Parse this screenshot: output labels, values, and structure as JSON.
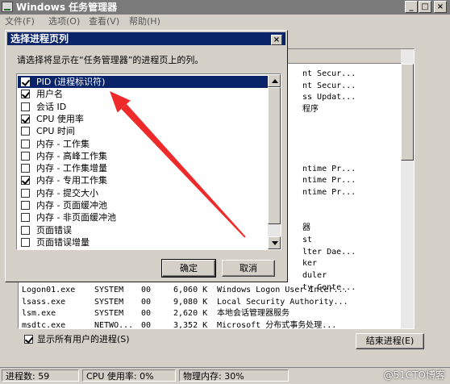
{
  "window": {
    "title": "Windows 任务管理器",
    "minimize": "_",
    "maximize": "□",
    "close": "×"
  },
  "menu": [
    "文件(F)",
    "选项(O)",
    "查看(V)",
    "帮助(H)"
  ],
  "background_list": {
    "right_fragments": [
      "nt Secur...",
      "nt Secur...",
      "ss Updat...",
      "程序",
      "",
      "",
      "",
      "",
      "ntime Pr...",
      "ntime Pr...",
      "ntime Pr...",
      "",
      "",
      "器",
      "st",
      "lter Dae...",
      "ker",
      "duler",
      "ty Cente..."
    ],
    "rows": [
      {
        "name": "Logon01.exe",
        "user": "SYSTEM",
        "cpu": "00",
        "mem": "6,060 K",
        "desc": "Windows Logon User Inter..."
      },
      {
        "name": "lsass.exe",
        "user": "SYSTEM",
        "cpu": "00",
        "mem": "9,080 K",
        "desc": "Local Security Authority..."
      },
      {
        "name": "lsm.exe",
        "user": "SYSTEM",
        "cpu": "00",
        "mem": "2,620 K",
        "desc": "本地会话管理器服务"
      },
      {
        "name": "msdtc.exe",
        "user": "NETWO...",
        "cpu": "00",
        "mem": "3,352 K",
        "desc": "Microsoft 分布式事务处理..."
      }
    ],
    "show_all_users_label": "显示所有用户的进程(S)",
    "show_all_users_checked": true,
    "end_process_label": "结束进程(E)"
  },
  "status": {
    "processes": "进程数: 59",
    "cpu": "CPU 使用率: 0%",
    "memory": "物理内存: 30%"
  },
  "watermark": "@51CTO博客",
  "dialog": {
    "title": "选择进程页列",
    "close": "×",
    "prompt": "请选择将显示在“任务管理器”的进程页上的列。",
    "columns": [
      {
        "label": "PID (进程标识符)",
        "checked": true,
        "selected": true
      },
      {
        "label": "用户名",
        "checked": true,
        "selected": false
      },
      {
        "label": "会话 ID",
        "checked": false,
        "selected": false
      },
      {
        "label": "CPU 使用率",
        "checked": true,
        "selected": false
      },
      {
        "label": "CPU 时间",
        "checked": false,
        "selected": false
      },
      {
        "label": "内存 - 工作集",
        "checked": false,
        "selected": false
      },
      {
        "label": "内存 - 高峰工作集",
        "checked": false,
        "selected": false
      },
      {
        "label": "内存 - 工作集增量",
        "checked": false,
        "selected": false
      },
      {
        "label": "内存 - 专用工作集",
        "checked": true,
        "selected": false
      },
      {
        "label": "内存 - 提交大小",
        "checked": false,
        "selected": false
      },
      {
        "label": "内存 - 页面缓冲池",
        "checked": false,
        "selected": false
      },
      {
        "label": "内存 - 非页面缓冲池",
        "checked": false,
        "selected": false
      },
      {
        "label": "页面错误",
        "checked": false,
        "selected": false
      },
      {
        "label": "页面错误增量",
        "checked": false,
        "selected": false
      }
    ],
    "ok_label": "确定",
    "cancel_label": "取消"
  },
  "colors": {
    "selection": "#0a246a",
    "dialog_face": "#d4d0c8",
    "annotation_arrow": "#ee2a2a"
  }
}
